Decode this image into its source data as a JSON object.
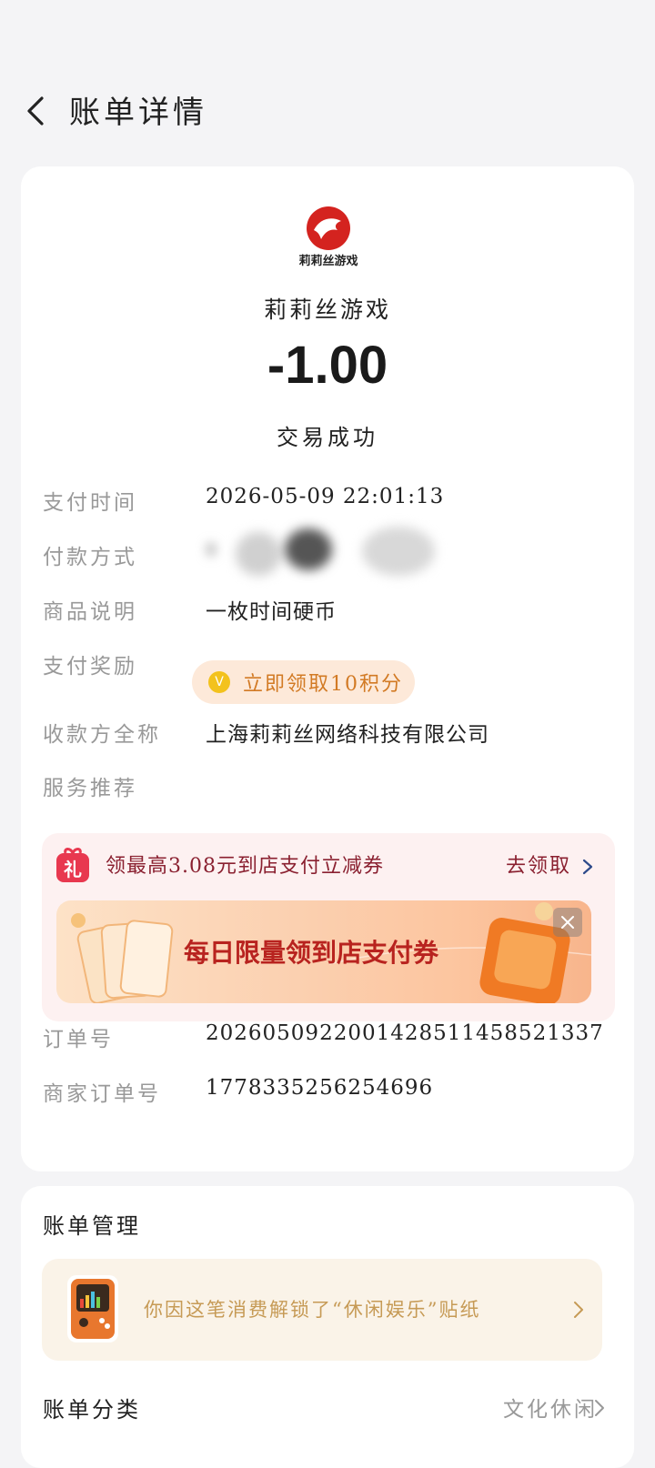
{
  "header": {
    "title": "账单详情",
    "back_icon": "back-chevron-icon"
  },
  "summary": {
    "logo_text": "莉莉丝游戏",
    "merchant_name": "莉莉丝游戏",
    "amount": "-1.00",
    "status": "交易成功"
  },
  "details": {
    "pay_time_label": "支付时间",
    "pay_time_value": "2026-05-09 22:01:13",
    "pay_method_label": "付款方式",
    "product_label": "商品说明",
    "product_value": "一枚时间硬币",
    "reward_label": "支付奖励",
    "reward_button": "立即领取10积分",
    "payee_label": "收款方全称",
    "payee_value": "上海莉莉丝网络科技有限公司",
    "service_label": "服务推荐",
    "order_label": "订单号",
    "order_value": "2026050922001428511458521337",
    "merchant_order_label": "商家订单号",
    "merchant_order_value": "1778335256254696"
  },
  "promo": {
    "gift_icon_text": "礼",
    "text": "领最高3.08元到店支付立减券",
    "link": "去领取",
    "banner_text": "每日限量领到店支付券"
  },
  "management": {
    "title": "账单管理",
    "sticker_text": "你因这笔消费解锁了“休闲娱乐”贴纸",
    "category_label": "账单分类",
    "category_value": "文化休闲"
  },
  "colors": {
    "background": "#f4f4f6",
    "brand_red": "#d4231f",
    "reward_orange": "#d27a24",
    "promo_text": "#8a2030",
    "sticker_gold": "#c69a55"
  }
}
